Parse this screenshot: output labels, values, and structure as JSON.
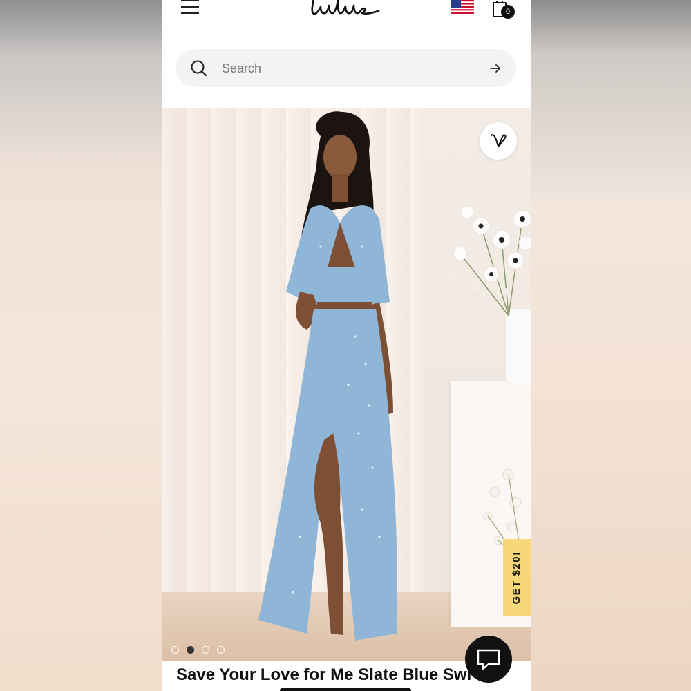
{
  "header": {
    "menu_icon": "hamburger-menu-icon",
    "logo_text": "Lulus",
    "flag_icon": "us-flag-icon",
    "cart_icon": "shopping-bag-icon",
    "cart_count": "0"
  },
  "search": {
    "placeholder": "Search",
    "search_icon": "search-icon",
    "submit_icon": "arrow-right-icon"
  },
  "product": {
    "image_alt_icon": "product-photo",
    "wishlist_icon": "heart-logo-icon",
    "promo_tab_label": "GET $20!",
    "carousel": {
      "total": 4,
      "active_index": 1
    },
    "title": "Save Your Love for Me Slate Blue Swi"
  },
  "chat": {
    "icon": "chat-bubble-icon"
  },
  "colors": {
    "promo_yellow": "#f8d67a",
    "dress_blue": "#8fb6d6",
    "dark": "#111111"
  }
}
